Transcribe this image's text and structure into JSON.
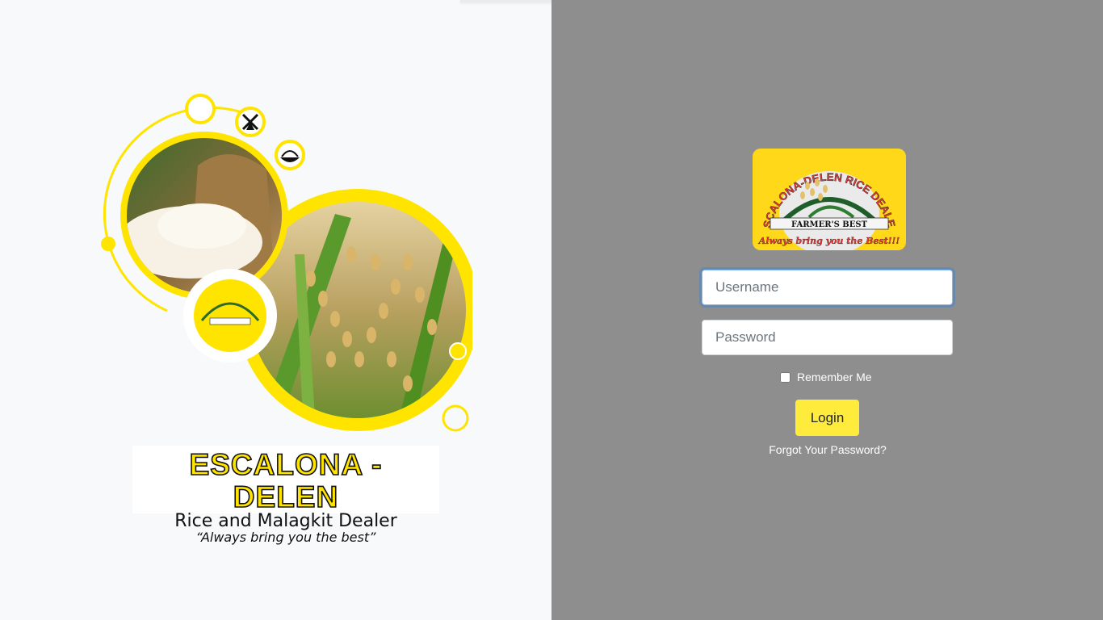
{
  "branding": {
    "title": "ESCALONA - DELEN",
    "subtitle": "Rice and Malagkit Dealer",
    "tagline": "“Always bring you the best”"
  },
  "logo": {
    "arc_text": "ESCALONA-DELEN RICE DEALER",
    "banner_text": "FARMER'S BEST",
    "slogan": "Always bring you the Best!!!"
  },
  "login_form": {
    "username": {
      "placeholder": "Username",
      "value": ""
    },
    "password": {
      "placeholder": "Password",
      "value": ""
    },
    "remember_label": "Remember Me",
    "remember_checked": false,
    "submit_label": "Login",
    "forgot_label": "Forgot Your Password?"
  },
  "icons": [
    "moon-icon",
    "windmill-icon",
    "rice-bowl-icon"
  ],
  "colors": {
    "accent_yellow": "#ffe400",
    "button_yellow": "#ffeb3b",
    "left_background": "#f8f9fa",
    "right_background": "#8e8e8e"
  }
}
